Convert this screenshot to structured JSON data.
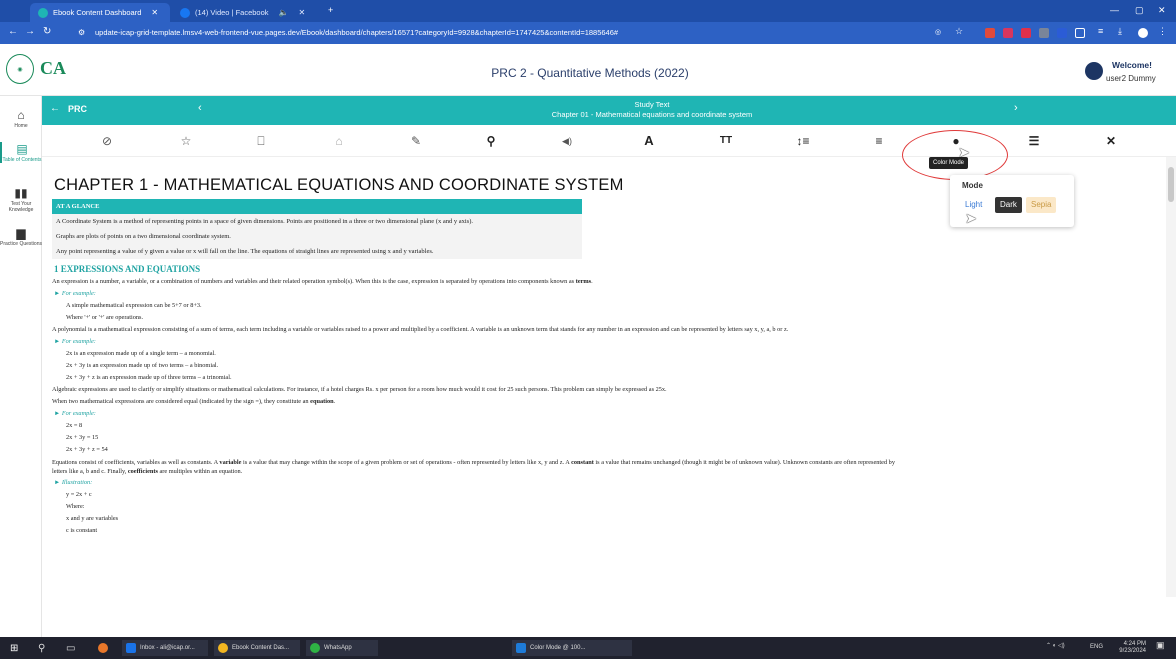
{
  "browser": {
    "tabs": [
      {
        "title": "Ebook Content Dashboard",
        "active": true
      },
      {
        "title": "(14) Video | Facebook",
        "active": false
      }
    ],
    "url": "update-icap-grid-template.lmsv4-web-frontend-vue.pages.dev/Ebook/dashboard/chapters/16571?categoryId=9928&chapterId=1747425&contentId=1885646#"
  },
  "header": {
    "logo_text": "CA",
    "title": "PRC 2 - Quantitative Methods (2022)",
    "welcome": "Welcome!",
    "username": "user2 Dummy"
  },
  "sidebar": {
    "items": [
      {
        "label": "Home"
      },
      {
        "label": "Table of Contents"
      },
      {
        "label": "Test Your Knowledge"
      },
      {
        "label": "Practice Questions"
      }
    ]
  },
  "nav": {
    "back_label": "PRC",
    "study_text": "Study Text",
    "chapter_subtitle": "Chapter 01 - Mathematical equations and coordinate system"
  },
  "tooltip": "Color Mode",
  "colormode": {
    "title": "Mode",
    "options": {
      "light": "Light",
      "dark": "Dark",
      "sepia": "Sepia"
    }
  },
  "content": {
    "chapter_title": "CHAPTER 1 - MATHEMATICAL EQUATIONS AND COORDINATE SYSTEM",
    "glance_title": "AT A GLANCE",
    "glance_lines": [
      "A Coordinate System is a method of representing points in a space of given dimensions. Points are positioned in a three or two dimensional plane (x and y axis).",
      "Graphs are plots of points on a two dimensional coordinate system.",
      "Any point representing a value of y given a value or x will fall on the line. The equations of straight lines are represented using x and y variables."
    ],
    "section_title": "1   EXPRESSIONS AND EQUATIONS",
    "p1_before": "An expression is a number, a variable, or a combination of numbers and variables and their related operation symbol(s). When this is the case, expression is separated by operations into components known as ",
    "p1_bold": "terms",
    "p1_after": ".",
    "for_example": "For example:",
    "ex1": [
      "A simple mathematical expression can be 5+7 or 8+3.",
      "Where '+' or '+' are operations."
    ],
    "p2": "A polynomial is a mathematical expression consisting of a sum of terms, each term including a variable or variables raised to a power and multiplied by a coefficient. A variable is an unknown term that stands for any number in an expression and can be represented by letters say x, y, a, b or z.",
    "ex2": [
      "2x is an expression made up of a single term – a monomial.",
      "2x + 3y is an expression made up of two terms – a binomial.",
      "2x + 3y + z is an expression made up of three terms – a trinomial."
    ],
    "p3": "Algebraic expressions are used to clarify or simplify situations or mathematical calculations. For instance, if a hotel charges Rs. x per person for a room how much would it cost for 25 such persons. This problem can simply be expressed as 25x.",
    "p4_before": "When two mathematical expressions are considered equal (indicated by the sign =), they constitute an ",
    "p4_bold": "equation",
    "p4_after": ".",
    "ex3": [
      "2x = 8",
      "2x + 3y = 15",
      "2x + 3y + z = 54"
    ],
    "p5_a": "Equations consist of coefficients, variables as well as constants. A ",
    "p5_b": "variable",
    "p5_c": " is a value that may change within the scope of a given problem or set of operations - often represented by letters like x, y and z. A ",
    "p5_d": "constant",
    "p5_e": " is a value that remains unchanged (though it might be of unknown value). Unknown constants are often represented by",
    "p5_line2_a": "letters like a, b and c. Finally, ",
    "p5_line2_b": "coefficients",
    "p5_line2_c": " are multiples within an equation.",
    "illustration": "Illustration:",
    "ill_lines": [
      "y = 2x + c",
      "Where:",
      "x and y are variables",
      "c is constant"
    ]
  },
  "taskbar": {
    "apps": [
      {
        "label": "Inbox - ali@icap.or..."
      },
      {
        "label": "Ebook Content Das..."
      },
      {
        "label": "WhatsApp"
      },
      {
        "label": "Color Mode @ 100..."
      }
    ],
    "lang": "ENG",
    "time": "4:24 PM",
    "date": "9/23/2024"
  },
  "colors": {
    "teal": "#1fb5b4",
    "browser_blue": "#2d61c4",
    "annotation_red": "#e03a3a"
  }
}
